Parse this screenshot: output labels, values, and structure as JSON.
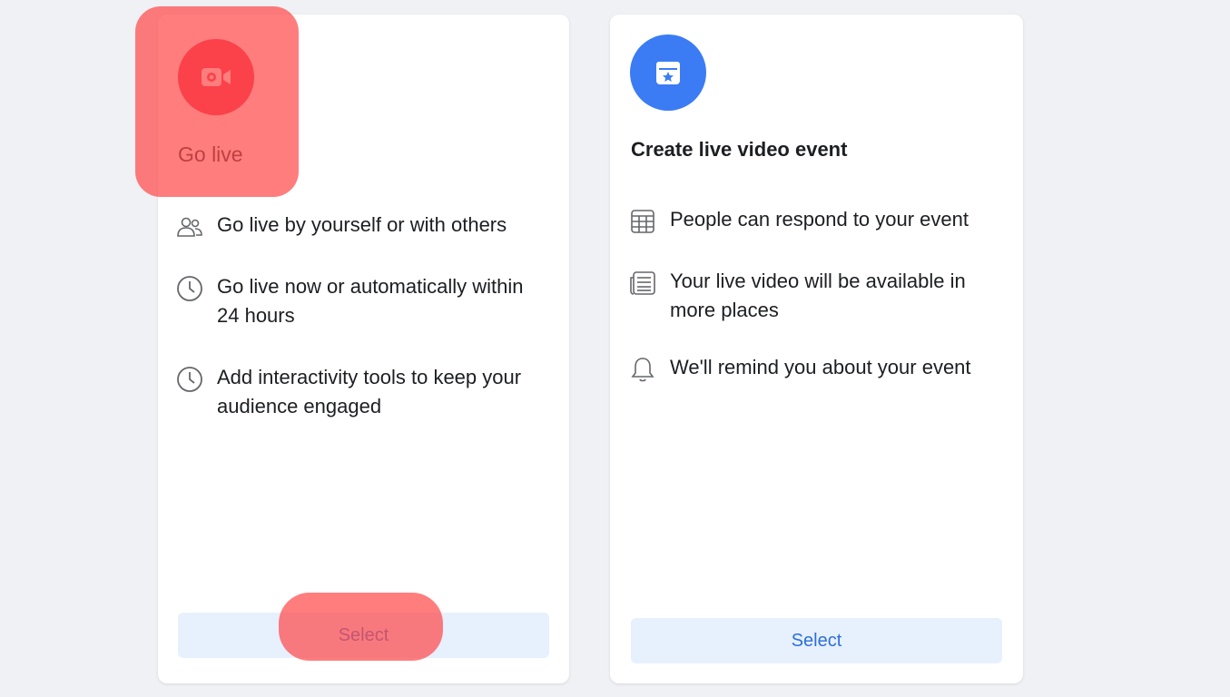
{
  "go_live": {
    "title": "Go live",
    "features": [
      {
        "icon": "people-icon",
        "text": "Go live by yourself or with others"
      },
      {
        "icon": "clock-icon",
        "text": "Go live now or automatically within 24 hours"
      },
      {
        "icon": "clock-icon",
        "text": "Add interactivity tools to keep your audience engaged"
      }
    ],
    "select_label": "Select",
    "accent": "#f0284a"
  },
  "live_event": {
    "title": "Create live video event",
    "features": [
      {
        "icon": "calendar-grid-icon",
        "text": "People can respond to your event"
      },
      {
        "icon": "news-feed-icon",
        "text": "Your live video will be available in more places"
      },
      {
        "icon": "bell-icon",
        "text": "We'll remind you about your event"
      }
    ],
    "select_label": "Select",
    "accent": "#3b7cf5"
  }
}
